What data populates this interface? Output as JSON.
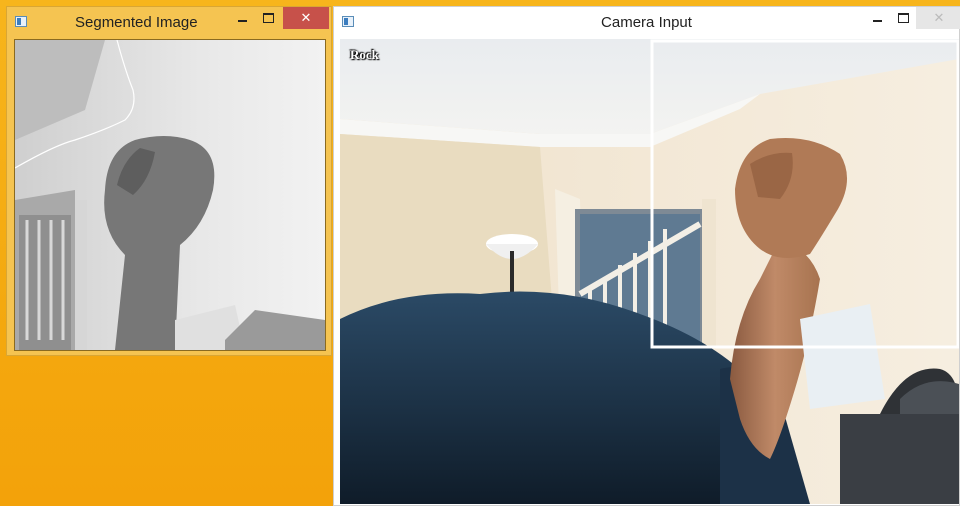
{
  "segmented_window": {
    "title": "Segmented Image",
    "controls": {
      "minimize": "",
      "maximize": "",
      "close": "✕"
    }
  },
  "camera_window": {
    "title": "Camera Input",
    "overlay_label": "Rock",
    "controls": {
      "minimize": "",
      "maximize": "",
      "close": "✕"
    }
  },
  "colors": {
    "desktop": "#f4a90f",
    "active_frame": "#f5c451",
    "close_active": "#c7514a",
    "roi_box": "#ffffff"
  }
}
